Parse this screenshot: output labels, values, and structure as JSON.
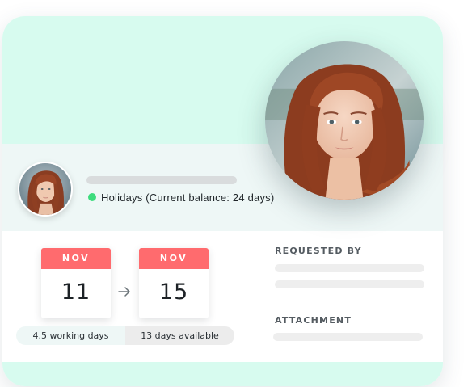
{
  "request": {
    "leave_type": "Holidays (Current balance: 24 days)",
    "status_color": "#3ddc7d"
  },
  "dates": {
    "from": {
      "month": "NOV",
      "day": "11"
    },
    "to": {
      "month": "NOV",
      "day": "15"
    },
    "arrow_icon": "arrow-right-icon"
  },
  "summary": {
    "working_days": "4.5 working days",
    "available": "13 days available"
  },
  "details": {
    "requested_by_label": "REQUESTED BY",
    "attachment_label": "ATTACHMENT"
  },
  "colors": {
    "mint": "#d7fbef",
    "strip": "#eef7f6",
    "calendar_header": "#ff6b6e"
  }
}
